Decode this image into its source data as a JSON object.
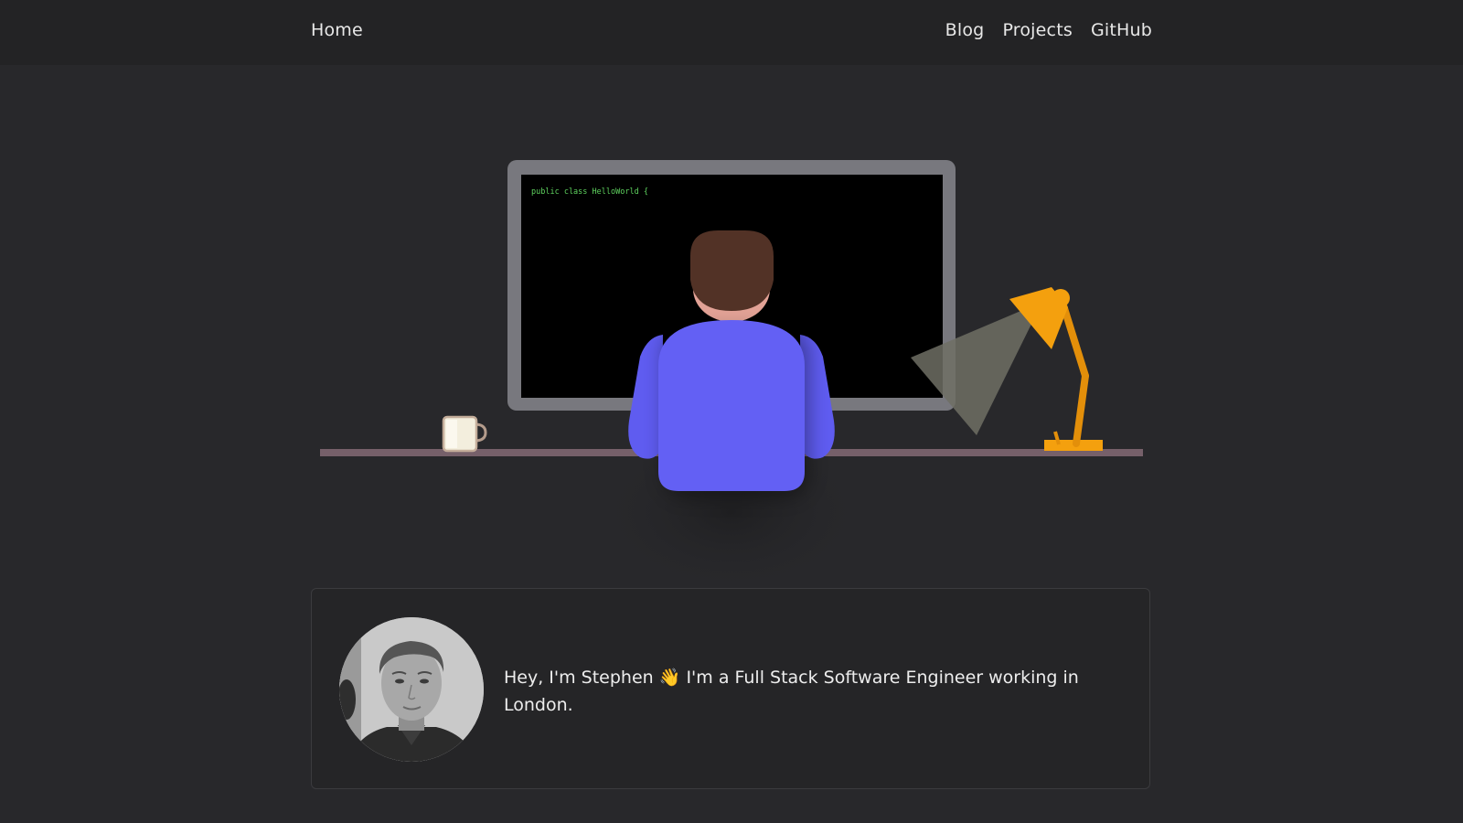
{
  "nav": {
    "home": "Home",
    "links": [
      "Blog",
      "Projects",
      "GitHub"
    ]
  },
  "scene": {
    "code_line": "public class HelloWorld {",
    "colors": {
      "monitor_frame": "#78787e",
      "screen": "#000000",
      "code_text": "#5fd35f",
      "hair": "#523226",
      "skin": "#e2a296",
      "shirt": "#6360f4",
      "desk": "#76606a",
      "lamp": "#f4a00e",
      "lamp_beam": "#6e6e64",
      "mug": "#f3eedd"
    }
  },
  "intro": {
    "text": "Hey, I'm Stephen 👋 I'm a Full Stack Software Engineer working in London."
  }
}
